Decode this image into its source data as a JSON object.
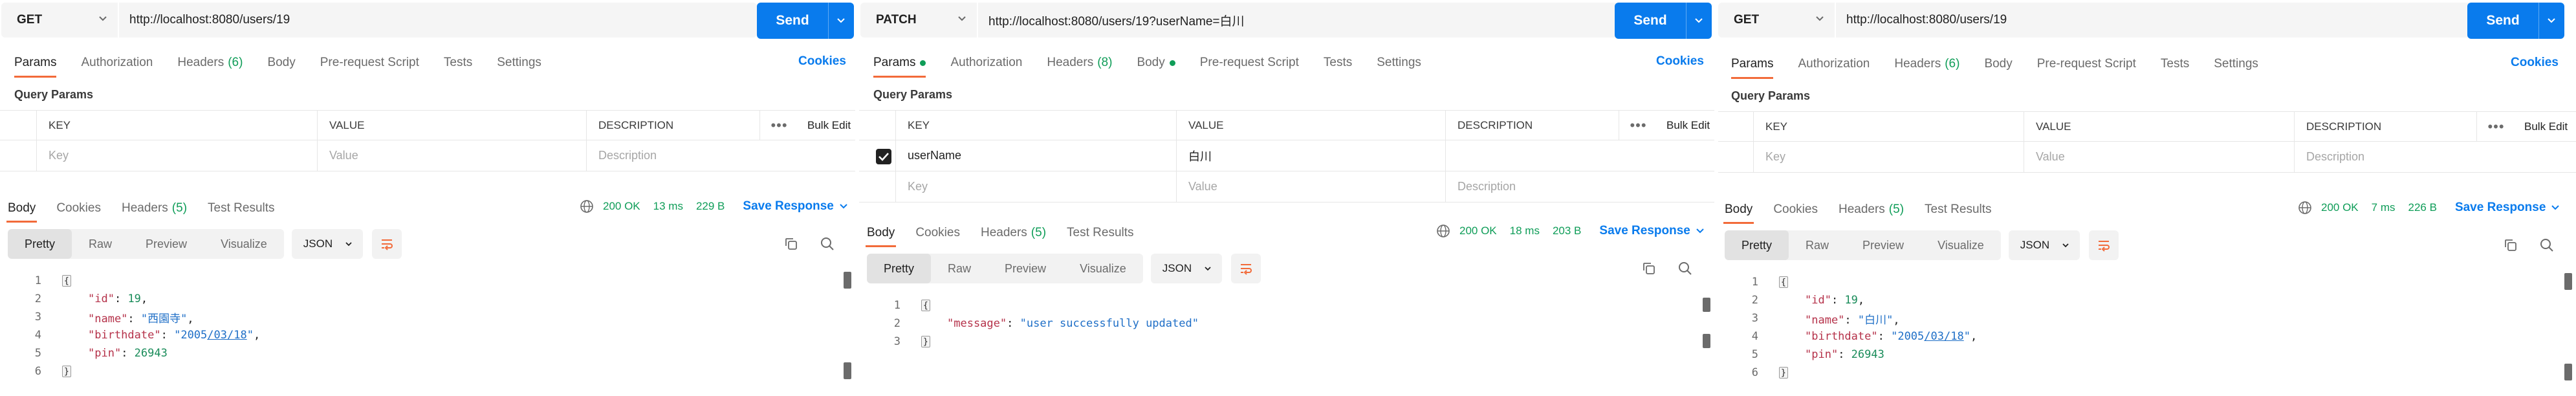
{
  "panels": [
    {
      "method": "GET",
      "url": "http://localhost:8080/users/19",
      "send_label": "Send",
      "cookies_label": "Cookies",
      "request_tabs": {
        "params": "Params",
        "authorization": "Authorization",
        "headers": "Headers",
        "headers_count": "(6)",
        "body": "Body",
        "prerequest": "Pre-request Script",
        "tests": "Tests",
        "settings": "Settings"
      },
      "query_params_title": "Query Params",
      "table": {
        "col_key": "KEY",
        "col_value": "VALUE",
        "col_description": "DESCRIPTION",
        "more": "•••",
        "bulk_edit": "Bulk Edit",
        "key_placeholder": "Key",
        "value_placeholder": "Value",
        "description_placeholder": "Description"
      },
      "response_tabs": {
        "body": "Body",
        "cookies": "Cookies",
        "headers": "Headers",
        "headers_count": "(5)",
        "test_results": "Test Results"
      },
      "status": {
        "code": "200 OK",
        "time": "13 ms",
        "size": "229 B",
        "save": "Save Response"
      },
      "view": {
        "pretty": "Pretty",
        "raw": "Raw",
        "preview": "Preview",
        "visualize": "Visualize",
        "format": "JSON"
      },
      "code_lines": {
        "n1": "1",
        "n2": "2",
        "n3": "3",
        "n4": "4",
        "n5": "5",
        "n6": "6",
        "open": "{",
        "k_id": "\"id\"",
        "v_id": "19",
        "k_name": "\"name\"",
        "v_name": "\"西園寺\"",
        "k_birthdate": "\"birthdate\"",
        "v_birthdate_q1": "\"",
        "v_birthdate_a": "2005",
        "v_birthdate_b": "/03/18",
        "v_birthdate_q2": "\"",
        "k_pin": "\"pin\"",
        "v_pin": "26943",
        "close": "}"
      }
    },
    {
      "method": "PATCH",
      "url": "http://localhost:8080/users/19?userName=白川",
      "send_label": "Send",
      "cookies_label": "Cookies",
      "request_tabs": {
        "params": "Params",
        "authorization": "Authorization",
        "headers": "Headers",
        "headers_count": "(8)",
        "body": "Body",
        "prerequest": "Pre-request Script",
        "tests": "Tests",
        "settings": "Settings"
      },
      "query_params_title": "Query Params",
      "table": {
        "col_key": "KEY",
        "col_value": "VALUE",
        "col_description": "DESCRIPTION",
        "more": "•••",
        "bulk_edit": "Bulk Edit",
        "row_key": "userName",
        "row_value": "白川",
        "key_placeholder": "Key",
        "value_placeholder": "Value",
        "description_placeholder": "Description"
      },
      "response_tabs": {
        "body": "Body",
        "cookies": "Cookies",
        "headers": "Headers",
        "headers_count": "(5)",
        "test_results": "Test Results"
      },
      "status": {
        "code": "200 OK",
        "time": "18 ms",
        "size": "203 B",
        "save": "Save Response"
      },
      "view": {
        "pretty": "Pretty",
        "raw": "Raw",
        "preview": "Preview",
        "visualize": "Visualize",
        "format": "JSON"
      },
      "code_lines": {
        "n1": "1",
        "n2": "2",
        "n3": "3",
        "open": "{",
        "k_message": "\"message\"",
        "v_message": "\"user successfully updated\"",
        "close": "}"
      }
    },
    {
      "method": "GET",
      "url": "http://localhost:8080/users/19",
      "send_label": "Send",
      "cookies_label": "Cookies",
      "request_tabs": {
        "params": "Params",
        "authorization": "Authorization",
        "headers": "Headers",
        "headers_count": "(6)",
        "body": "Body",
        "prerequest": "Pre-request Script",
        "tests": "Tests",
        "settings": "Settings"
      },
      "query_params_title": "Query Params",
      "table": {
        "col_key": "KEY",
        "col_value": "VALUE",
        "col_description": "DESCRIPTION",
        "more": "•••",
        "bulk_edit": "Bulk Edit",
        "key_placeholder": "Key",
        "value_placeholder": "Value",
        "description_placeholder": "Description"
      },
      "response_tabs": {
        "body": "Body",
        "cookies": "Cookies",
        "headers": "Headers",
        "headers_count": "(5)",
        "test_results": "Test Results"
      },
      "status": {
        "code": "200 OK",
        "time": "7 ms",
        "size": "226 B",
        "save": "Save Response"
      },
      "view": {
        "pretty": "Pretty",
        "raw": "Raw",
        "preview": "Preview",
        "visualize": "Visualize",
        "format": "JSON"
      },
      "code_lines": {
        "n1": "1",
        "n2": "2",
        "n3": "3",
        "n4": "4",
        "n5": "5",
        "n6": "6",
        "open": "{",
        "k_id": "\"id\"",
        "v_id": "19",
        "k_name": "\"name\"",
        "v_name": "\"白川\"",
        "k_birthdate": "\"birthdate\"",
        "v_birthdate_q1": "\"",
        "v_birthdate_a": "2005",
        "v_birthdate_b": "/03/18",
        "v_birthdate_q2": "\"",
        "k_pin": "\"pin\"",
        "v_pin": "26943",
        "close": "}"
      }
    }
  ],
  "icons": {
    "method_dropdown": "chevron-down-icon",
    "send_dropdown": "chevron-down-icon",
    "globe": "globe-icon",
    "save_dropdown": "chevron-down-icon",
    "wrap": "wrap-lines-icon",
    "copy": "copy-icon",
    "search": "search-icon",
    "checkbox": "checkbox-checked-icon"
  },
  "colors": {
    "accent_blue": "#097bed",
    "status_green": "#0f9d58",
    "tab_underline": "#f26b3a",
    "json_key": "#b5324a",
    "json_string": "#1f6fc7",
    "json_number": "#1a8c5a"
  }
}
